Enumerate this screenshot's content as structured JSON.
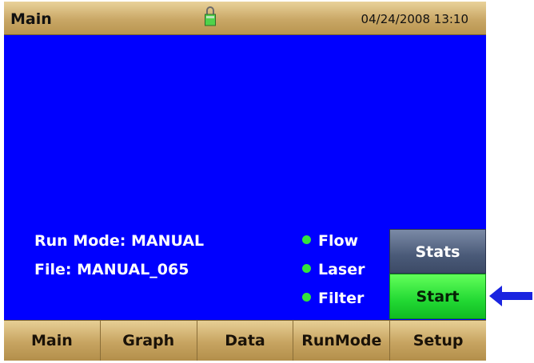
{
  "header": {
    "title": "Main",
    "datetime": "04/24/2008 13:10",
    "lock_icon": "padlock-icon"
  },
  "info": {
    "run_mode": "Run Mode: MANUAL",
    "file": "File: MANUAL_065"
  },
  "status_indicators": [
    {
      "label": "Flow",
      "color": "#33e33b"
    },
    {
      "label": "Laser",
      "color": "#33e33b"
    },
    {
      "label": "Filter",
      "color": "#33e33b"
    }
  ],
  "buttons": {
    "stats": "Stats",
    "start": "Start"
  },
  "nav": [
    "Main",
    "Graph",
    "Data",
    "RunMode",
    "Setup"
  ],
  "colors": {
    "background": "#0000ff",
    "bar": "#c9a766",
    "start": "#22d833",
    "arrow": "#1a24e0"
  }
}
